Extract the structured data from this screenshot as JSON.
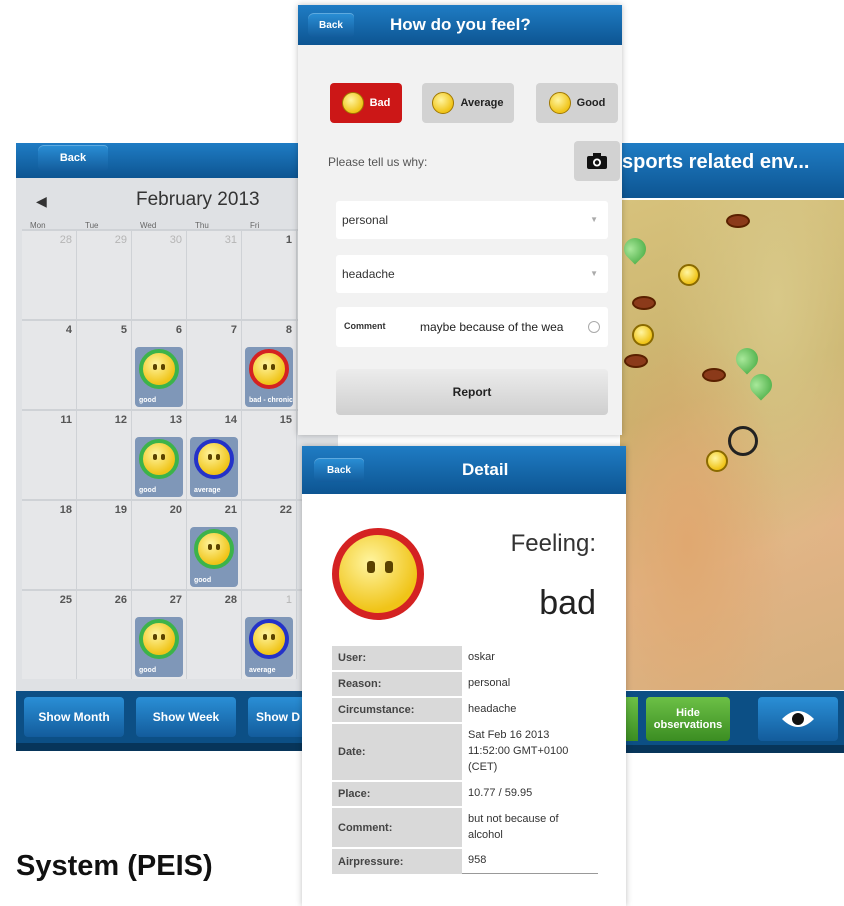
{
  "calendar": {
    "back_label": "Back",
    "month_label": "February 2013",
    "weekdays": [
      "Mon",
      "Tue",
      "Wed",
      "Thu",
      "Fri"
    ],
    "days": [
      [
        "28",
        "29",
        "30",
        "31",
        "1"
      ],
      [
        "4",
        "5",
        "6",
        "7",
        "8"
      ],
      [
        "11",
        "12",
        "13",
        "14",
        "15"
      ],
      [
        "18",
        "19",
        "20",
        "21",
        "22"
      ],
      [
        "25",
        "26",
        "27",
        "28",
        "1"
      ]
    ],
    "events": [
      {
        "label": "good",
        "mood": "good"
      },
      {
        "label": "bad - chronic",
        "mood": "bad"
      },
      {
        "label": "good",
        "mood": "good"
      },
      {
        "label": "average",
        "mood": "average"
      },
      {
        "label": "good",
        "mood": "good"
      },
      {
        "label": "good",
        "mood": "good"
      },
      {
        "label": "average",
        "mood": "average"
      }
    ],
    "footer": {
      "show_month": "Show Month",
      "show_week": "Show Week",
      "show_day": "Show D"
    }
  },
  "map": {
    "title": "sports related env...",
    "hide_observations": "Hide observations",
    "eye_icon": "eye-icon"
  },
  "feel": {
    "back_label": "Back",
    "title": "How do you feel?",
    "moods": {
      "bad": "Bad",
      "average": "Average",
      "good": "Good"
    },
    "why_label": "Please tell us why:",
    "reason_value": "personal",
    "circumstance_value": "headache",
    "comment_label": "Comment",
    "comment_value": "maybe because of the wea",
    "report_label": "Report",
    "colors": {
      "selected": "#cc1717",
      "unselected": "#d2d2d2"
    }
  },
  "detail": {
    "back_label": "Back",
    "title": "Detail",
    "feeling_label": "Feeling:",
    "feeling_value": "bad",
    "rows": [
      {
        "key": "User:",
        "value": "oskar"
      },
      {
        "key": "Reason:",
        "value": "personal"
      },
      {
        "key": "Circumstance:",
        "value": "headache"
      },
      {
        "key": "Date:",
        "value": "Sat Feb 16 2013 11:52:00 GMT+0100 (CET)"
      },
      {
        "key": "Place:",
        "value": "10.77 / 59.95"
      },
      {
        "key": "Comment:",
        "value": "but not because of alcohol"
      },
      {
        "key": "Airpressure:",
        "value": "958"
      }
    ]
  },
  "caption": "System (PEIS)",
  "colors": {
    "bar": "#1a6fb3",
    "footer": "#0c4f85",
    "green_button": "#4ea832"
  }
}
